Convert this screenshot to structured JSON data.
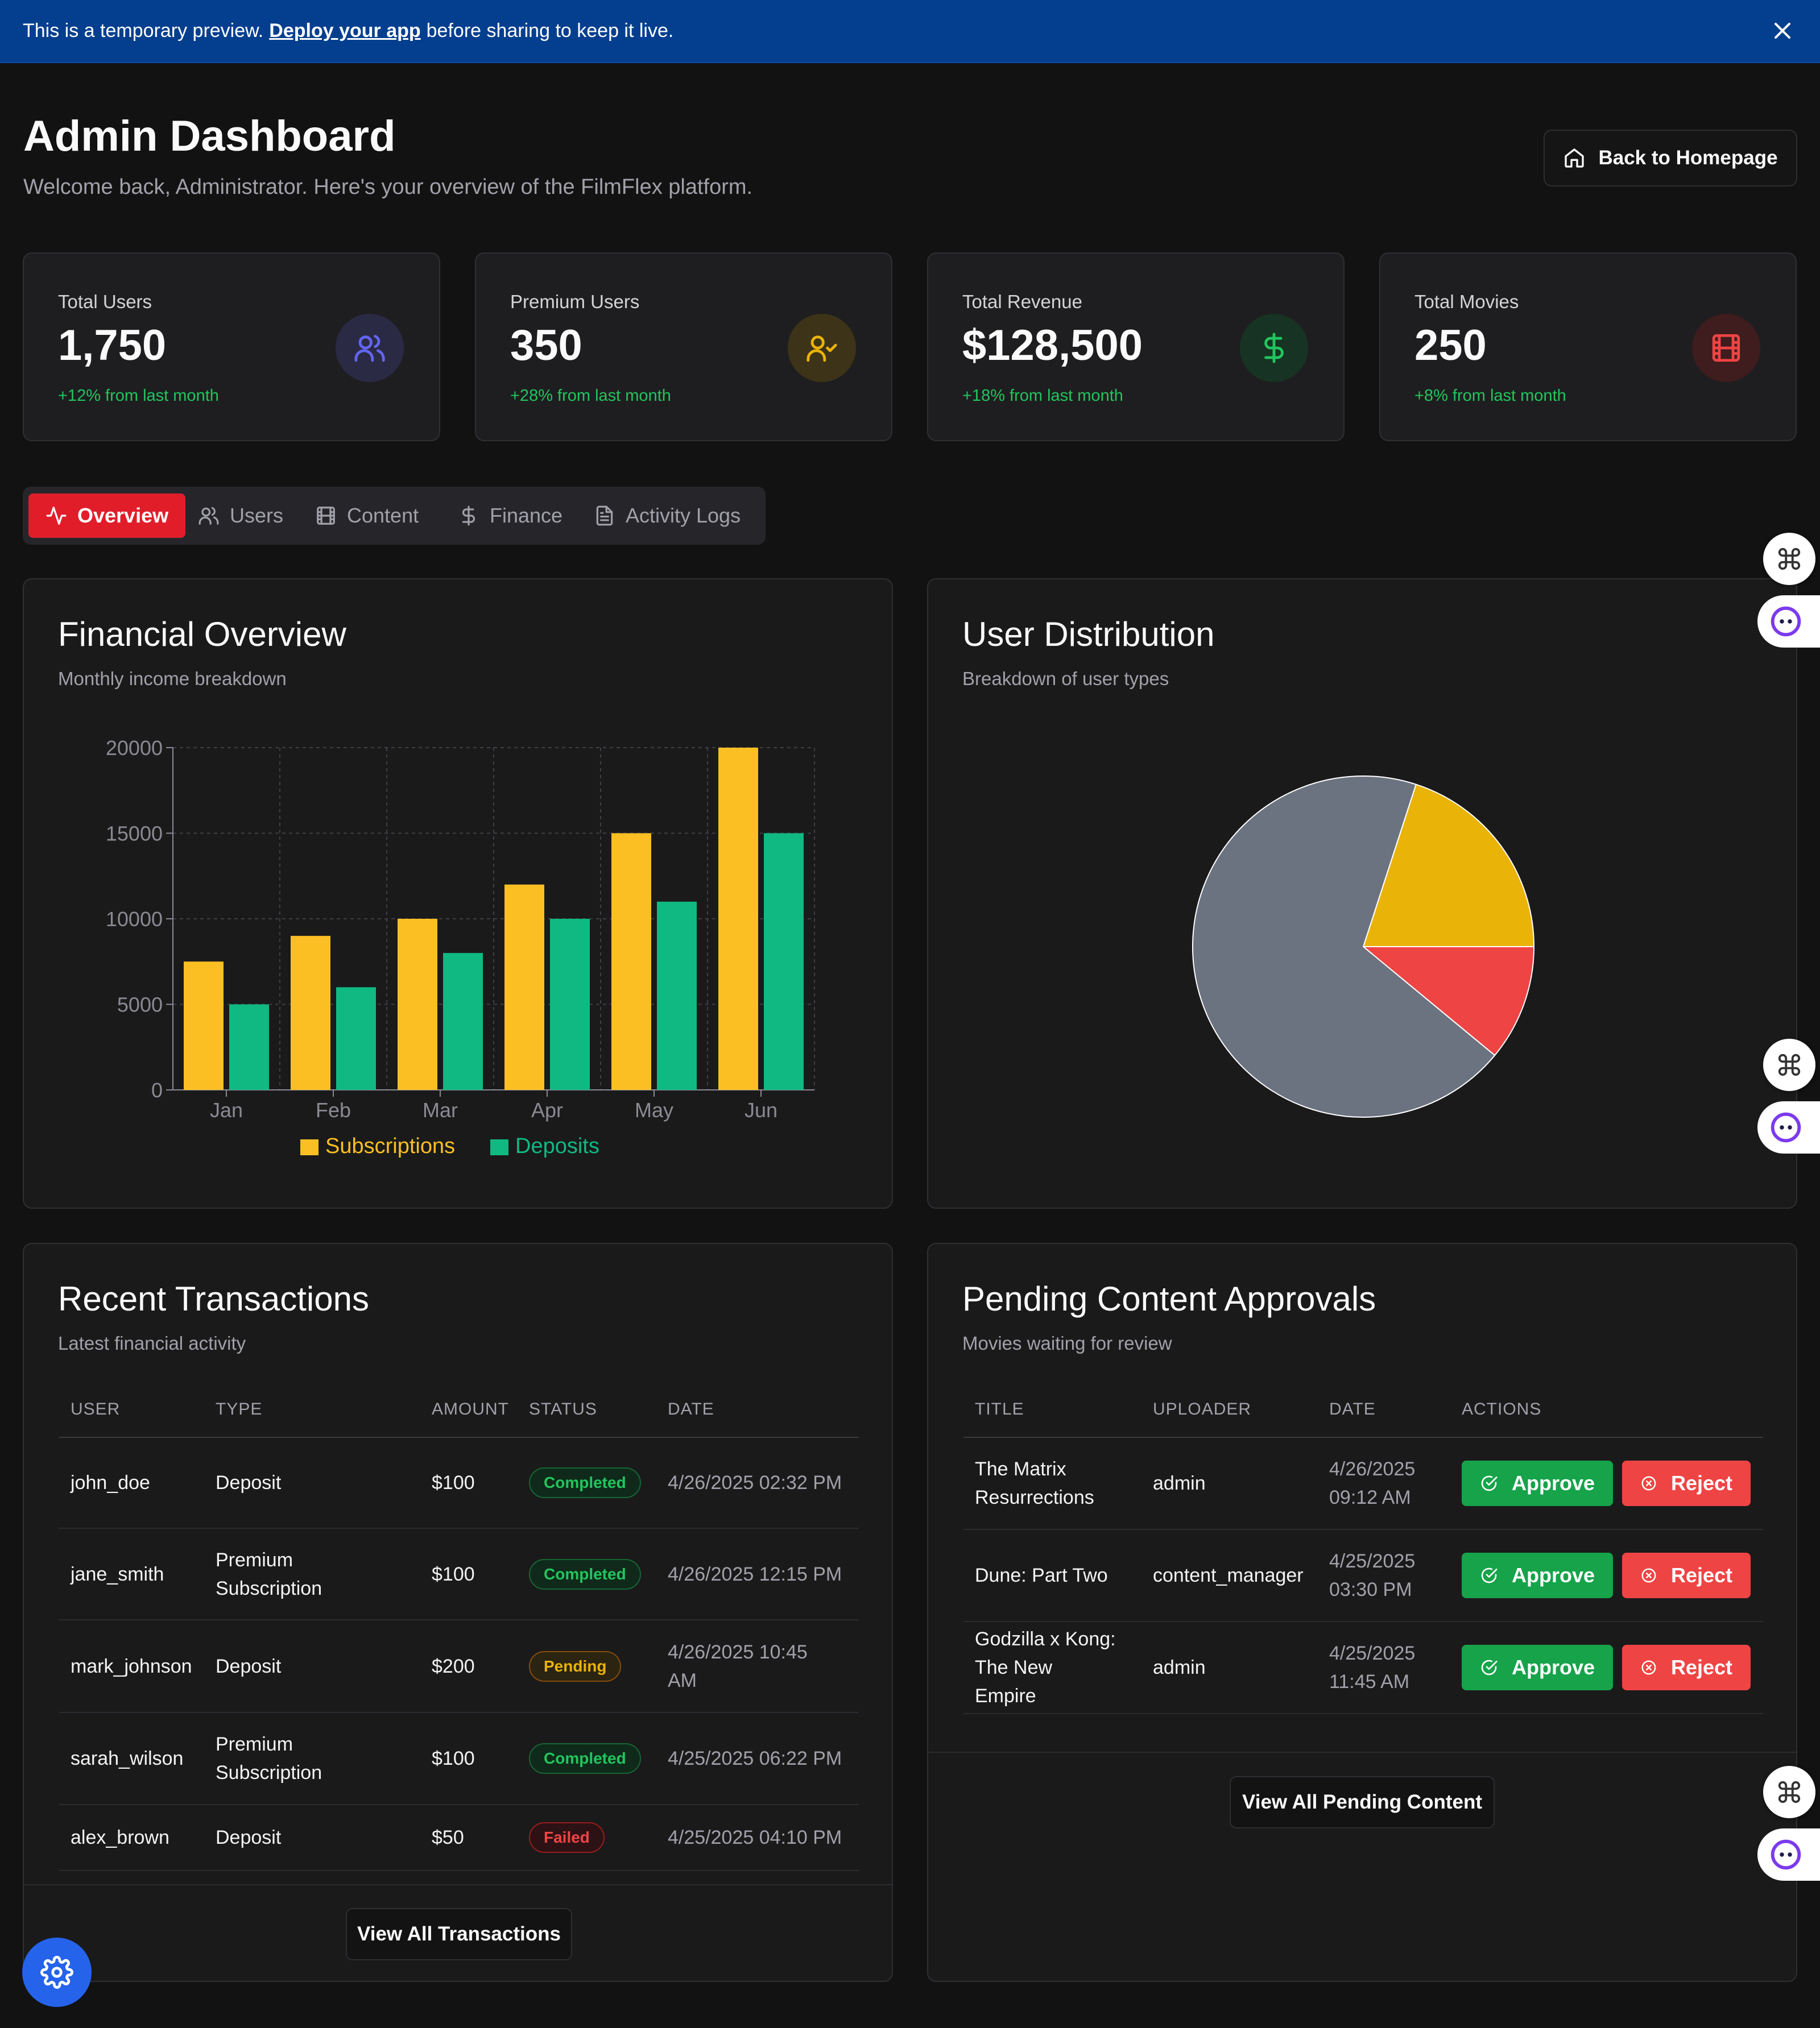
{
  "banner": {
    "text_before": "This is a temporary preview.",
    "link": "Deploy your app",
    "text_after": "before sharing to keep it live."
  },
  "header": {
    "title": "Admin Dashboard",
    "subtitle": "Welcome back, Administrator. Here's your overview of the FilmFlex platform.",
    "home_button": "Back to Homepage"
  },
  "stats": [
    {
      "label": "Total Users",
      "value": "1,750",
      "change": "+12% from last month",
      "icon": "users-icon",
      "color": "#6366f1",
      "bg": "#2a2a45"
    },
    {
      "label": "Premium Users",
      "value": "350",
      "change": "+28% from last month",
      "icon": "user-check-icon",
      "color": "#eab308",
      "bg": "#3d3318"
    },
    {
      "label": "Total Revenue",
      "value": "$128,500",
      "change": "+18% from last month",
      "icon": "dollar-icon",
      "color": "#22c55e",
      "bg": "#173323"
    },
    {
      "label": "Total Movies",
      "value": "250",
      "change": "+8% from last month",
      "icon": "film-icon",
      "color": "#ef4444",
      "bg": "#3f1c1e"
    }
  ],
  "tabs": [
    {
      "label": "Overview",
      "icon": "activity-icon",
      "active": true
    },
    {
      "label": "Users",
      "icon": "users-icon",
      "active": false
    },
    {
      "label": "Content",
      "icon": "film-icon",
      "active": false
    },
    {
      "label": "Finance",
      "icon": "dollar-icon",
      "active": false
    },
    {
      "label": "Activity Logs",
      "icon": "file-text-icon",
      "active": false
    }
  ],
  "financial": {
    "title": "Financial Overview",
    "subtitle": "Monthly income breakdown"
  },
  "distribution": {
    "title": "User Distribution",
    "subtitle": "Breakdown of user types"
  },
  "chart_data": [
    {
      "type": "bar",
      "categories": [
        "Jan",
        "Feb",
        "Mar",
        "Apr",
        "May",
        "Jun"
      ],
      "series": [
        {
          "name": "Subscriptions",
          "values": [
            7500,
            9000,
            10000,
            12000,
            15000,
            20000
          ],
          "color": "#fbbf24"
        },
        {
          "name": "Deposits",
          "values": [
            5000,
            6000,
            8000,
            10000,
            11000,
            15000
          ],
          "color": "#10b981"
        }
      ],
      "yticks": [
        0,
        5000,
        10000,
        15000,
        20000
      ],
      "ylim": [
        0,
        20000
      ],
      "grid": true,
      "legend": "bottom"
    },
    {
      "type": "pie",
      "slices": [
        {
          "value": 20,
          "color": "#eab308"
        },
        {
          "value": 11,
          "color": "#ef4444"
        },
        {
          "value": 69,
          "color": "#6b7280"
        }
      ]
    }
  ],
  "transactions": {
    "title": "Recent Transactions",
    "subtitle": "Latest financial activity",
    "columns": [
      "USER",
      "TYPE",
      "AMOUNT",
      "STATUS",
      "DATE"
    ],
    "rows": [
      {
        "user": "john_doe",
        "type": "Deposit",
        "amount": "$100",
        "status": "Completed",
        "date": "4/26/2025 02:32 PM"
      },
      {
        "user": "jane_smith",
        "type": "Premium Subscription",
        "amount": "$100",
        "status": "Completed",
        "date": "4/26/2025 12:15 PM"
      },
      {
        "user": "mark_johnson",
        "type": "Deposit",
        "amount": "$200",
        "status": "Pending",
        "date": "4/26/2025 10:45 AM"
      },
      {
        "user": "sarah_wilson",
        "type": "Premium Subscription",
        "amount": "$100",
        "status": "Completed",
        "date": "4/25/2025 06:22 PM"
      },
      {
        "user": "alex_brown",
        "type": "Deposit",
        "amount": "$50",
        "status": "Failed",
        "date": "4/25/2025 04:10 PM"
      }
    ],
    "footer_button": "View All Transactions"
  },
  "approvals": {
    "title": "Pending Content Approvals",
    "subtitle": "Movies waiting for review",
    "columns": [
      "TITLE",
      "UPLOADER",
      "DATE",
      "ACTIONS"
    ],
    "rows": [
      {
        "title": "The Matrix Resurrections",
        "uploader": "admin",
        "date": "4/26/2025 09:12 AM"
      },
      {
        "title": "Dune: Part Two",
        "uploader": "content_manager",
        "date": "4/25/2025 03:30 PM"
      },
      {
        "title": "Godzilla x Kong: The New Empire",
        "uploader": "admin",
        "date": "4/25/2025 11:45 AM"
      }
    ],
    "approve_label": "Approve",
    "reject_label": "Reject",
    "footer_button": "View All Pending Content"
  }
}
